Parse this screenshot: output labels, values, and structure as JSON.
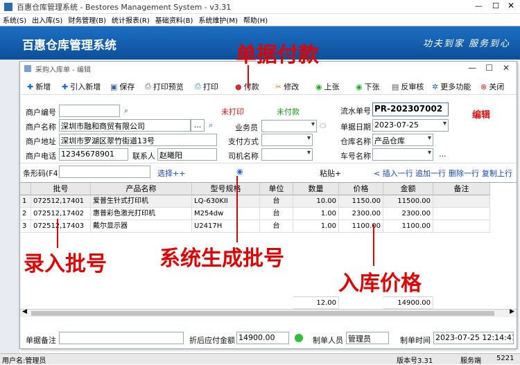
{
  "app": {
    "title": "百惠仓库管理系统 - Bestores Management System - v3.31",
    "brand": "百惠仓库管理系统",
    "slogan": "功夫到家 服务到心"
  },
  "menu": [
    "系统(S)",
    "出入库(S)",
    "财务管理(B)",
    "统计报表(R)",
    "基础资料(B)",
    "系统维护(M)",
    "帮助(H)"
  ],
  "window": {
    "title": "采购入库单 - 编辑"
  },
  "toolbar": [
    {
      "icon": "plus-icon",
      "label": "新增"
    },
    {
      "icon": "import-icon",
      "label": "引入新增"
    },
    {
      "icon": "save-icon",
      "label": "保存"
    },
    {
      "icon": "preview-icon",
      "label": "打印预览"
    },
    {
      "icon": "print-icon",
      "label": "打印"
    },
    {
      "icon": "pay-icon",
      "label": "付款"
    },
    {
      "icon": "edit-icon",
      "label": "修改"
    },
    {
      "icon": "prev-icon",
      "label": "上张"
    },
    {
      "icon": "next-icon",
      "label": "下张"
    },
    {
      "icon": "unapprove-icon",
      "label": "反审核"
    },
    {
      "icon": "more-icon",
      "label": "更多功能"
    },
    {
      "icon": "close-icon",
      "label": "关闭"
    }
  ],
  "form": {
    "merchant_code_label": "商户编号",
    "merchant_code": "",
    "status_print": "未打印",
    "status_pay": "未付款",
    "serial_label": "流水单号",
    "serial": "PR-202307002",
    "edit_tag": "编辑",
    "merchant_name_label": "商户名称",
    "merchant_name": "深圳市融和商贸有限公司",
    "salesman_label": "业务员",
    "salesman": "",
    "date_label": "单据日期",
    "date": "2023-07-25",
    "address_label": "商户地址",
    "address": "深圳市罗湖区翠竹街道13号",
    "paymethod_label": "支付方式",
    "paymethod": "",
    "warehouse_label": "仓库名称",
    "warehouse": "产品仓库",
    "phone_label": "商户电话",
    "phone": "12345678901",
    "contact_label": "联系人",
    "contact": "赵曦阳",
    "driver_label": "司机名称",
    "driver": "",
    "plate_label": "车号名称",
    "plate": "",
    "ellipsis": "...",
    "barcode_label": "条形码(F4)",
    "barcode": "",
    "select_link": "选择++",
    "paste_link": "粘贴+",
    "insert_row": "< 插入一行",
    "append_row": "追加一行",
    "delete_row": "删除一行",
    "copy_row": "复制上行"
  },
  "table": {
    "columns": [
      "批号",
      "产品名称",
      "型号规格",
      "单位",
      "数量",
      "价格",
      "金额",
      "备注"
    ],
    "rows": [
      {
        "no": "1",
        "batch": "072512,17401",
        "name": "爱普生针式打印机",
        "model": "LQ-630KII",
        "unit": "台",
        "qty": "10.00",
        "price": "1150.00",
        "amount": "11500.00",
        "note": ""
      },
      {
        "no": "2",
        "batch": "072512,17402",
        "name": "惠普彩色激光打印机",
        "model": "M254dw",
        "unit": "台",
        "qty": "1.00",
        "price": "2300.00",
        "amount": "2300.00",
        "note": ""
      },
      {
        "no": "3",
        "batch": "072512,17403",
        "name": "戴尔显示器",
        "model": "U2417H",
        "unit": "台",
        "qty": "1.00",
        "price": "1100.00",
        "amount": "1100.00",
        "note": ""
      }
    ],
    "total_qty": "12.00",
    "total_amount": "14900.00"
  },
  "footer": {
    "remark_label": "单据备注",
    "remark": "",
    "due_label": "折后应付金额",
    "due": "14900.00",
    "maker_label": "制单人员",
    "maker": "管理员",
    "time_label": "制单时间",
    "time": "2023-07-25 12:14:41"
  },
  "status": {
    "user": "用户名:管理员",
    "version": "版本号3.31",
    "service": "服务端",
    "port": "5221"
  },
  "annotations": {
    "pay": "单据付款",
    "batch_input": "录入批号",
    "batch_gen": "系统生成批号",
    "price": "入库价格"
  }
}
